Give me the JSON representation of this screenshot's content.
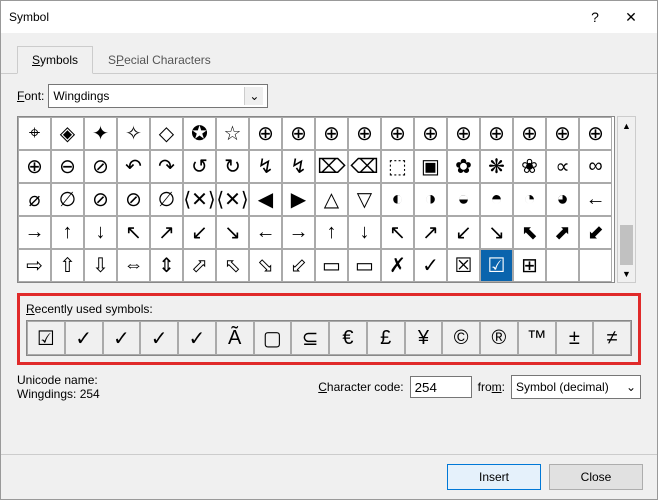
{
  "title": "Symbol",
  "help": "?",
  "close": "✕",
  "tabs": {
    "symbols": "Symbols",
    "special": "Special Characters",
    "symbols_u": "S",
    "special_u": "P"
  },
  "font_label_pre": "F",
  "font_label": "ont:",
  "font_value": "Wingdings",
  "grid": [
    [
      "⌖",
      "◈",
      "✦",
      "✧",
      "◇",
      "✪",
      "☆",
      "⊕",
      "⊕",
      "⊕",
      "⊕",
      "⊕",
      "⊕",
      "⊕",
      "⊕",
      "⊕",
      "⊕",
      "⊕"
    ],
    [
      "⊕",
      "⊖",
      "⊘",
      "↶",
      "↷",
      "↺",
      "↻",
      "↯",
      "↯",
      "⌦",
      "⌫",
      "⬚",
      "▣",
      "✿",
      "❋",
      "❀",
      "∝",
      "∞"
    ],
    [
      "⌀",
      "∅",
      "⊘",
      "⊘",
      "∅",
      "⟨✕⟩",
      "⟨✕⟩",
      "◀",
      "▶",
      "△",
      "▽",
      "◐",
      "◑",
      "◒",
      "◓",
      "◔",
      "◕",
      "←"
    ],
    [
      "→",
      "↑",
      "↓",
      "↖",
      "↗",
      "↙",
      "↘",
      "←",
      "→",
      "↑",
      "↓",
      "↖",
      "↗",
      "↙",
      "↘",
      "⬉",
      "⬈",
      "⬋"
    ],
    [
      "⇨",
      "⇧",
      "⇩",
      "⇔",
      "⇕",
      "⬀",
      "⬁",
      "⬂",
      "⬃",
      "▭",
      "▭",
      "✗",
      "✓",
      "☒",
      "☑",
      "⊞",
      "",
      ""
    ]
  ],
  "selected": {
    "row": 4,
    "col": 14
  },
  "recent_label_pre": "R",
  "recent_label": "ecently used symbols:",
  "recent": [
    "☑",
    "✓",
    "✓",
    "✓",
    "✓",
    "Ã",
    "▢",
    "⊆",
    "€",
    "£",
    "¥",
    "©",
    "®",
    "™",
    "±",
    "≠"
  ],
  "unicode_name_label": "Unicode name:",
  "unicode_value": "Wingdings: 254",
  "charcode_label_pre": "C",
  "charcode_label": "haracter code:",
  "charcode_value": "254",
  "from_label_pre": "",
  "from_label": "from:",
  "from_u": "m",
  "from_value": "Symbol (decimal)",
  "insert": "Insert",
  "cancel": "Close"
}
